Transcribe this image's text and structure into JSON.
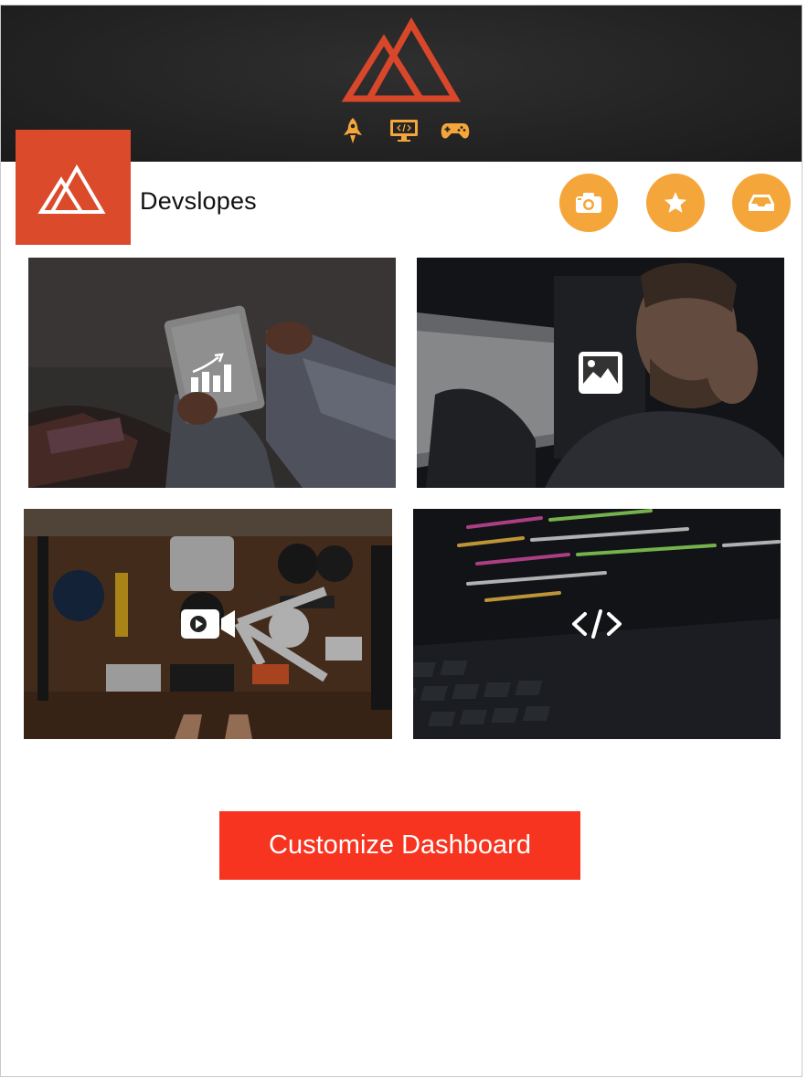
{
  "brand": {
    "name": "Devslopes",
    "accent_color": "#db4a2b",
    "icon": "mountain-logo-icon"
  },
  "header": {
    "logo_icon": "mountain-logo-icon",
    "icons": [
      "rocket-icon",
      "code-monitor-icon",
      "gamepad-icon"
    ],
    "icon_color": "#f5a63a"
  },
  "toolbar": {
    "buttons": [
      {
        "icon": "camera-icon"
      },
      {
        "icon": "star-icon"
      },
      {
        "icon": "inbox-icon"
      }
    ],
    "button_color": "#f5a63a"
  },
  "tiles": [
    {
      "icon": "chart-icon",
      "code_text": ""
    },
    {
      "icon": "image-icon",
      "code_text": ""
    },
    {
      "icon": "video-camera-icon",
      "code_text": ""
    },
    {
      "icon": "code-icon",
      "code_text": "</>"
    }
  ],
  "cta": {
    "label": "Customize Dashboard",
    "color": "#f7341f"
  }
}
